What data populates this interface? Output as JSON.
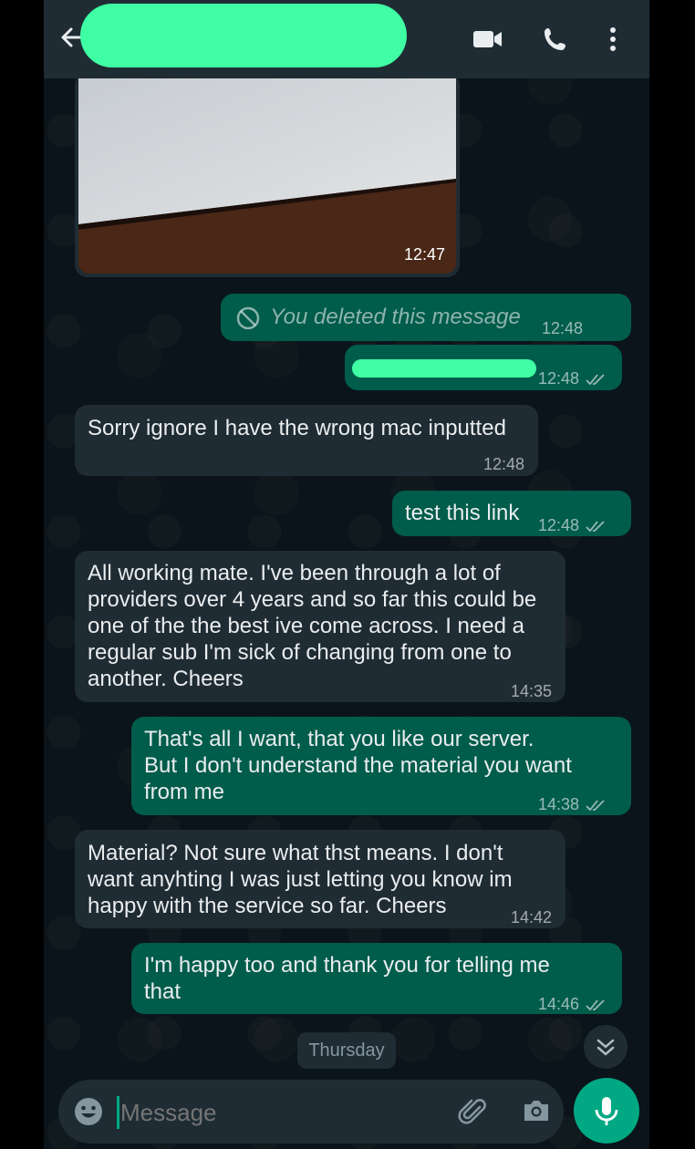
{
  "header": {
    "back_label": "back",
    "call_icons": [
      "video-call-icon",
      "voice-call-icon",
      "more-options-icon"
    ]
  },
  "messages": [
    {
      "type": "image",
      "time": "12:47"
    },
    {
      "type": "deleted",
      "text": "You deleted this message",
      "time": "12:48"
    },
    {
      "type": "outgoing-redacted",
      "time": "12:48"
    },
    {
      "type": "incoming",
      "text": "Sorry ignore I have the wrong mac inputted",
      "time": "12:48"
    },
    {
      "type": "outgoing",
      "text": "test this link",
      "time": "12:48"
    },
    {
      "type": "incoming",
      "text": "All working mate. I've been through a lot of\nproviders over 4 years and so far this could be\none of the the best ive come across. I need a\nregular sub I'm sick of changing from one to\nanother. Cheers",
      "time": "14:35"
    },
    {
      "type": "outgoing",
      "text": "That's all I want, that you like our server.\nBut I don't understand the material you want\nfrom me",
      "time": "14:38"
    },
    {
      "type": "incoming",
      "text": "Material? Not sure what thst means. I don't\nwant anyhting I was just letting you know im\nhappy with the service so far. Cheers",
      "time": "14:42"
    },
    {
      "type": "outgoing",
      "text": "I'm happy too and thank you for telling me\nthat",
      "time": "14:46"
    }
  ],
  "date_pill": "Thursday",
  "composer": {
    "placeholder": "Message"
  },
  "colors": {
    "outgoing": "#005c4b",
    "incoming": "#202c33",
    "accent": "#00a884",
    "redaction": "#3ffea3"
  }
}
